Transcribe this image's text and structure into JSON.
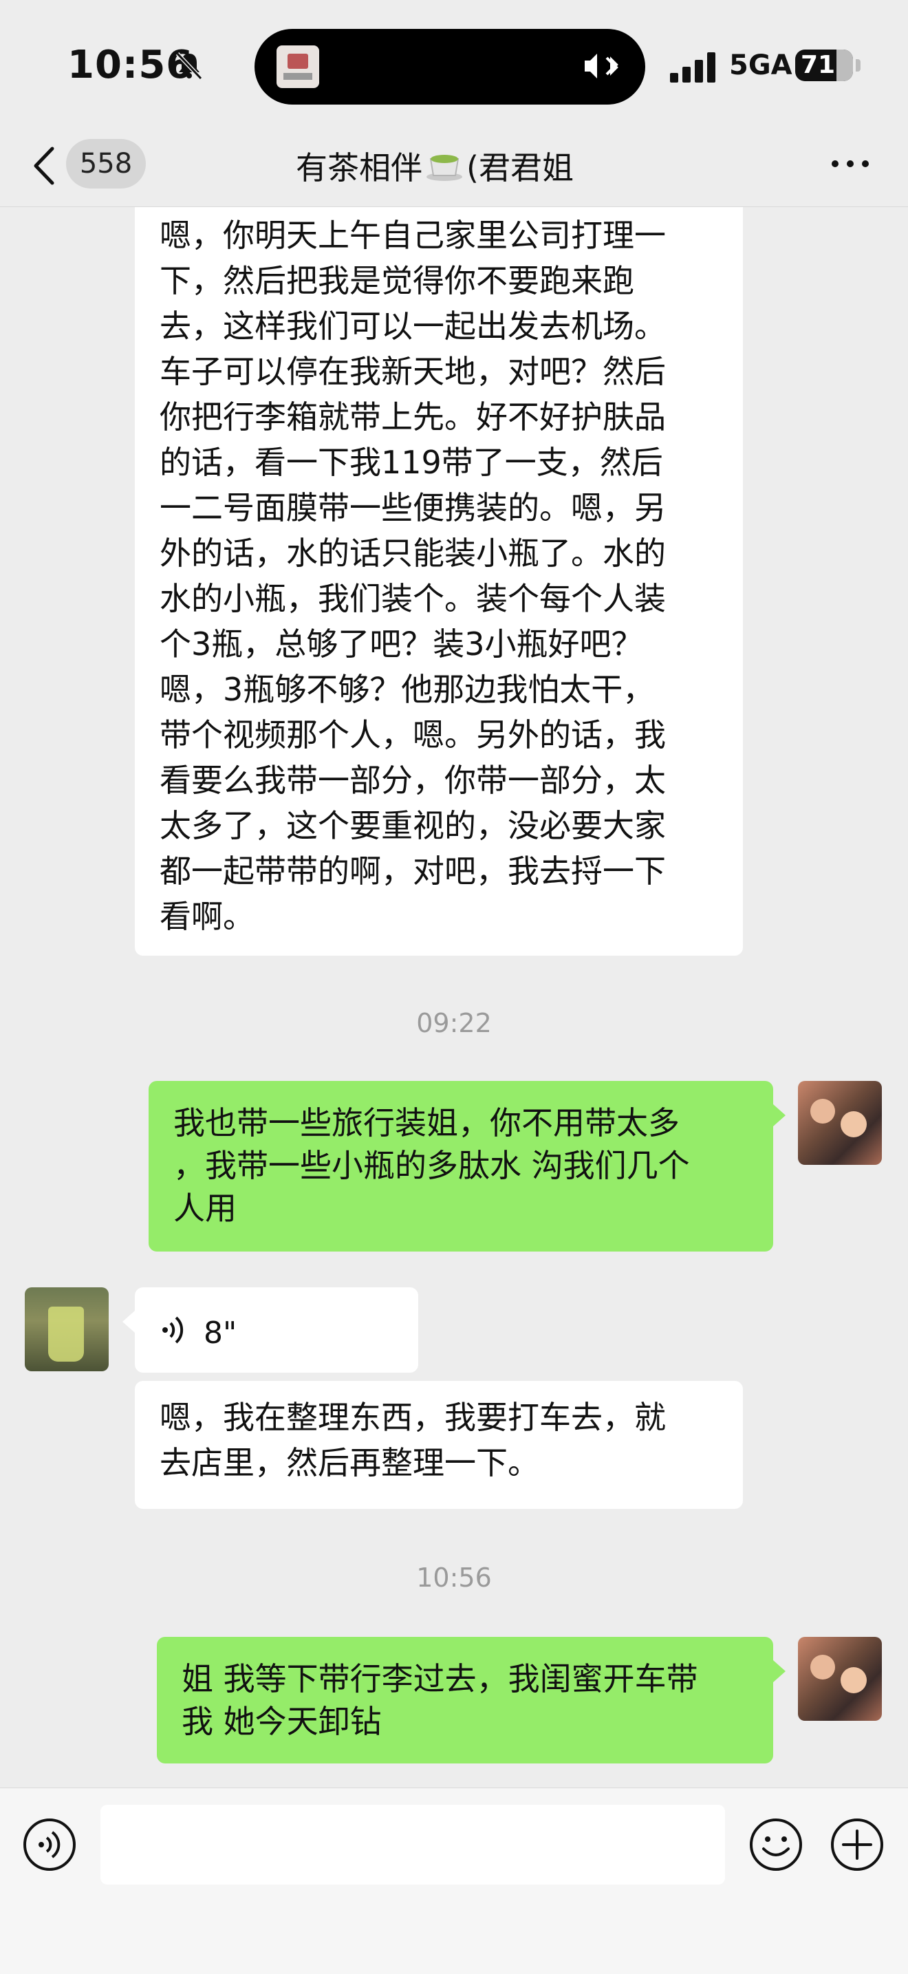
{
  "status_bar": {
    "time": "10:56",
    "network": "5GA",
    "battery": "71"
  },
  "nav": {
    "unread_count": "558",
    "title_prefix": "有茶相伴",
    "title_suffix": "(君君姐"
  },
  "messages": {
    "left_long_lines": [
      "嗯，你明天上午自己家里公司打理一",
      "下，然后把我是觉得你不要跑来跑",
      "去，这样我们可以一起出发去机场。",
      "车子可以停在我新天地，对吧？然后",
      "你把行李箱就带上先。好不好护肤品",
      "的话，看一下我119带了一支，然后",
      "一二号面膜带一些便携装的。嗯，另",
      "外的话，水的话只能装小瓶了。水的",
      "水的小瓶，我们装个。装个每个人装",
      "个3瓶，总够了吧？装3小瓶好吧？",
      "嗯，3瓶够不够？他那边我怕太干，",
      "带个视频那个人，嗯。另外的话，我",
      "看要么我带一部分，你带一部分，太",
      "太多了，这个要重视的，没必要大家",
      "都一起带带的啊，对吧，我去捋一下",
      "看啊。"
    ],
    "timestamp_1": "09:22",
    "right_1_lines": [
      "我也带一些旅行装姐，你不用带太多",
      "，我带一些小瓶的多肽水 沟我们几个",
      "人用"
    ],
    "voice_length": "8\"",
    "left_short_lines": [
      "嗯，我在整理东西，我要打车去，就",
      "去店里，然后再整理一下。"
    ],
    "timestamp_2": "10:56",
    "right_2_lines": [
      "姐 我等下带行李过去，我闺蜜开车带",
      "我 她今天卸钻"
    ]
  },
  "input": {
    "value": "",
    "placeholder": ""
  },
  "colors": {
    "background": "#ededed",
    "bubble_self": "#95ec69",
    "bubble_other": "#ffffff"
  }
}
